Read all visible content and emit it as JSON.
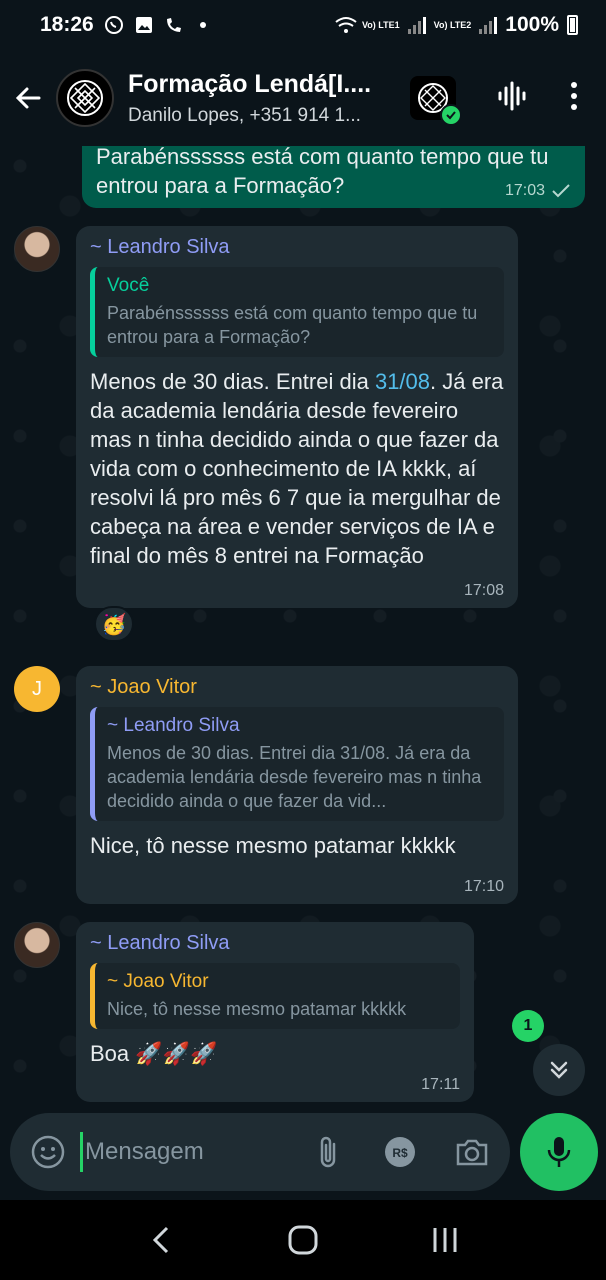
{
  "status_bar": {
    "time": "18:26",
    "net1": "Vo) LTE1",
    "net2": "Vo) LTE2",
    "battery": "100%"
  },
  "header": {
    "title": "Formação Lendá[I....",
    "subtitle": "Danilo Lopes, +351 914 1..."
  },
  "messages": [
    {
      "id": "m1",
      "direction": "outgoing",
      "text": "Parabénssssss está com quanto tempo que tu entrou para a Formação?",
      "time": "17:03"
    },
    {
      "id": "m2",
      "direction": "incoming",
      "sender": "~ Leandro Silva",
      "quote_name": "Você",
      "quote_text": "Parabénssssss está com quanto tempo que tu entrou para a Formação?",
      "text_before": "Menos de 30 dias. Entrei dia ",
      "date_link": "31/08",
      "text_after": ". Já era da academia lendária desde fevereiro mas n tinha decidido ainda o que fazer da vida com o conhecimento de IA kkkk, aí resolvi lá pro mês 6 7 que ia mergulhar de cabeça na área e vender serviços de IA e final do mês 8 entrei na Formação",
      "time": "17:08",
      "reaction": "🥳"
    },
    {
      "id": "m3",
      "direction": "incoming",
      "sender": "~ Joao Vitor",
      "avatar_letter": "J",
      "quote_name": "~ Leandro Silva",
      "quote_text": "Menos de 30 dias. Entrei dia 31/08. Já era da academia lendária desde fevereiro mas n tinha decidido ainda o que fazer da vid...",
      "text": "Nice, tô nesse mesmo patamar kkkkk",
      "time": "17:10"
    },
    {
      "id": "m4",
      "direction": "incoming",
      "sender": "~ Leandro Silva",
      "quote_name": "~ Joao Vitor",
      "quote_text": "Nice, tô nesse mesmo patamar kkkkk",
      "text": "Boa 🚀🚀🚀",
      "time": "17:11"
    }
  ],
  "unread_count": "1",
  "input": {
    "placeholder": "Mensagem",
    "value": ""
  },
  "colors": {
    "accent": "#25d366",
    "outgoing_bubble": "#005c4b",
    "incoming_bubble": "#1f2c33",
    "sender_blue": "#8f9cf5",
    "sender_yellow": "#f7b731"
  },
  "icons": [
    "whatsapp-icon",
    "gallery-icon",
    "call-icon",
    "wifi-icon",
    "back-arrow-icon",
    "group-logo-icon",
    "meta-ai-icon",
    "voice-wave-icon",
    "more-vert-icon",
    "emoji-icon",
    "attach-icon",
    "pix-icon",
    "camera-icon",
    "mic-icon",
    "chevrons-down-icon",
    "nav-back-icon",
    "nav-home-icon",
    "nav-recents-icon"
  ]
}
